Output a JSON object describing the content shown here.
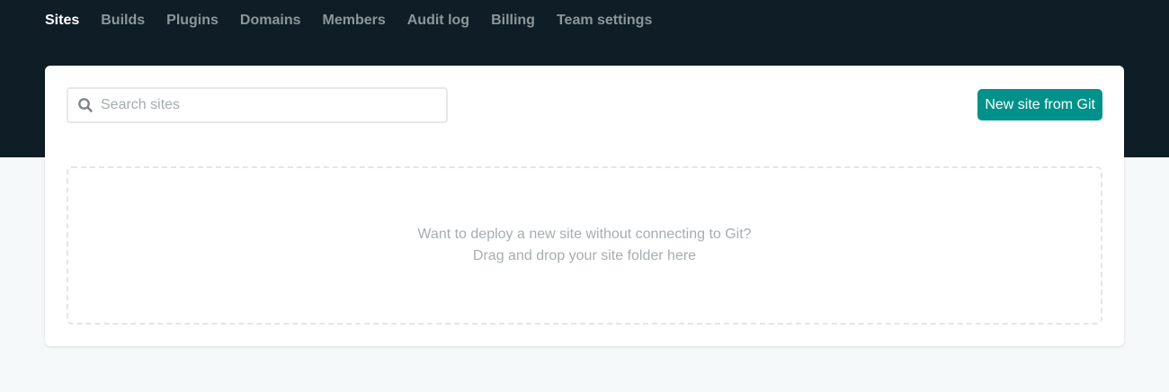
{
  "nav": {
    "items": [
      {
        "label": "Sites",
        "active": true
      },
      {
        "label": "Builds"
      },
      {
        "label": "Plugins"
      },
      {
        "label": "Domains"
      },
      {
        "label": "Members"
      },
      {
        "label": "Audit log"
      },
      {
        "label": "Billing"
      },
      {
        "label": "Team settings"
      }
    ]
  },
  "search": {
    "placeholder": "Search sites",
    "value": "",
    "icon": "search-icon"
  },
  "actions": {
    "new_site_label": "New site from Git"
  },
  "dropzone": {
    "line1": "Want to deploy a new site without connecting to Git?",
    "line2": "Drag and drop your site folder here"
  },
  "colors": {
    "header_bg": "#0f1e26",
    "page_bg": "#f5f9fa",
    "accent": "#00928a",
    "nav_active": "#ffffff",
    "nav_inactive": "#8c969b"
  }
}
